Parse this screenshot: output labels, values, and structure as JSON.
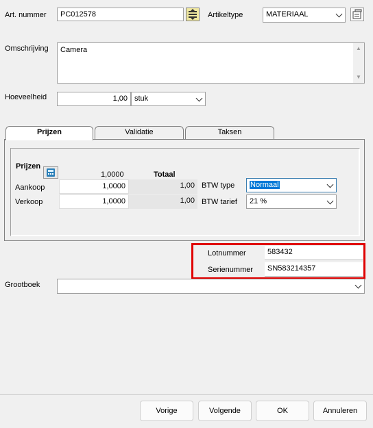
{
  "art_nummer": {
    "label": "Art. nummer",
    "value": "PC012578"
  },
  "artikeltype": {
    "label": "Artikeltype",
    "value": "MATERIAAL"
  },
  "omschrijving": {
    "label": "Omschrijving",
    "value": "Camera"
  },
  "hoeveelheid": {
    "label": "Hoeveelheid",
    "value": "1,00",
    "unit": "stuk"
  },
  "tabs": [
    {
      "label": "Prijzen",
      "active": true
    },
    {
      "label": "Validatie",
      "active": false
    },
    {
      "label": "Taksen",
      "active": false
    }
  ],
  "prijzen": {
    "title": "Prijzen",
    "col_qty": "1,0000",
    "col_total": "Totaal",
    "rows": [
      {
        "label": "Aankoop",
        "price": "1,0000",
        "total": "1,00"
      },
      {
        "label": "Verkoop",
        "price": "1,0000",
        "total": "1,00"
      }
    ],
    "btw_type": {
      "label": "BTW type",
      "value": "Normaal"
    },
    "btw_tarief": {
      "label": "BTW tarief",
      "value": "21 %"
    }
  },
  "lotnummer": {
    "label": "Lotnummer",
    "value": "583432"
  },
  "serienummer": {
    "label": "Serienummer",
    "value": "SN583214357"
  },
  "grootboek": {
    "label": "Grootboek",
    "value": ""
  },
  "buttons": {
    "vorige": "Vorige",
    "volgende": "Volgende",
    "ok": "OK",
    "annuleren": "Annuleren"
  },
  "highlight_color": "#e00000"
}
